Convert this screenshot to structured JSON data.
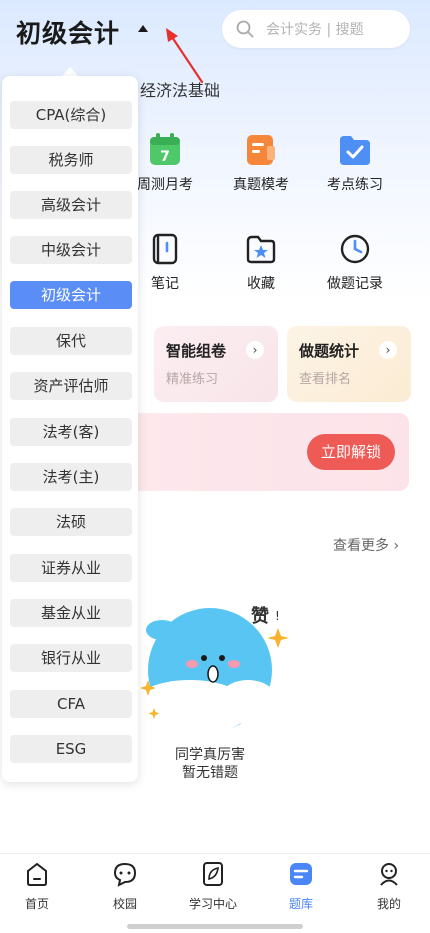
{
  "header": {
    "exam_title": "初级会计",
    "search_placeholder": "会计实务 | 搜题"
  },
  "subject": "经济法基础",
  "features_row1": [
    "周测月考",
    "真题模考",
    "考点练习"
  ],
  "calendar_day": "7",
  "features_row2": [
    "笔记",
    "收藏",
    "做题记录"
  ],
  "cards": [
    {
      "title": "智能组卷",
      "subtitle": "精准练习"
    },
    {
      "title": "做题统计",
      "subtitle": "查看排名"
    }
  ],
  "unlock_button": "立即解锁",
  "see_more": "查看更多",
  "mascot_text": "赞",
  "mascot_mark": "!",
  "empty_line1": "同学真厉害",
  "empty_line2": "暂无错题",
  "dropdown": {
    "items": [
      "CPA(综合)",
      "税务师",
      "高级会计",
      "中级会计",
      "初级会计",
      "保代",
      "资产评估师",
      "法考(客)",
      "法考(主)",
      "法硕",
      "证券从业",
      "基金从业",
      "银行从业",
      "CFA",
      "ESG"
    ],
    "selected": "初级会计"
  },
  "bottom_nav": [
    "首页",
    "校园",
    "学习中心",
    "题库",
    "我的"
  ],
  "bottom_nav_active": "题库",
  "colors": {
    "accent": "#5b8df6",
    "unlock": "#ee5a55",
    "annotation": "#e5322d"
  }
}
